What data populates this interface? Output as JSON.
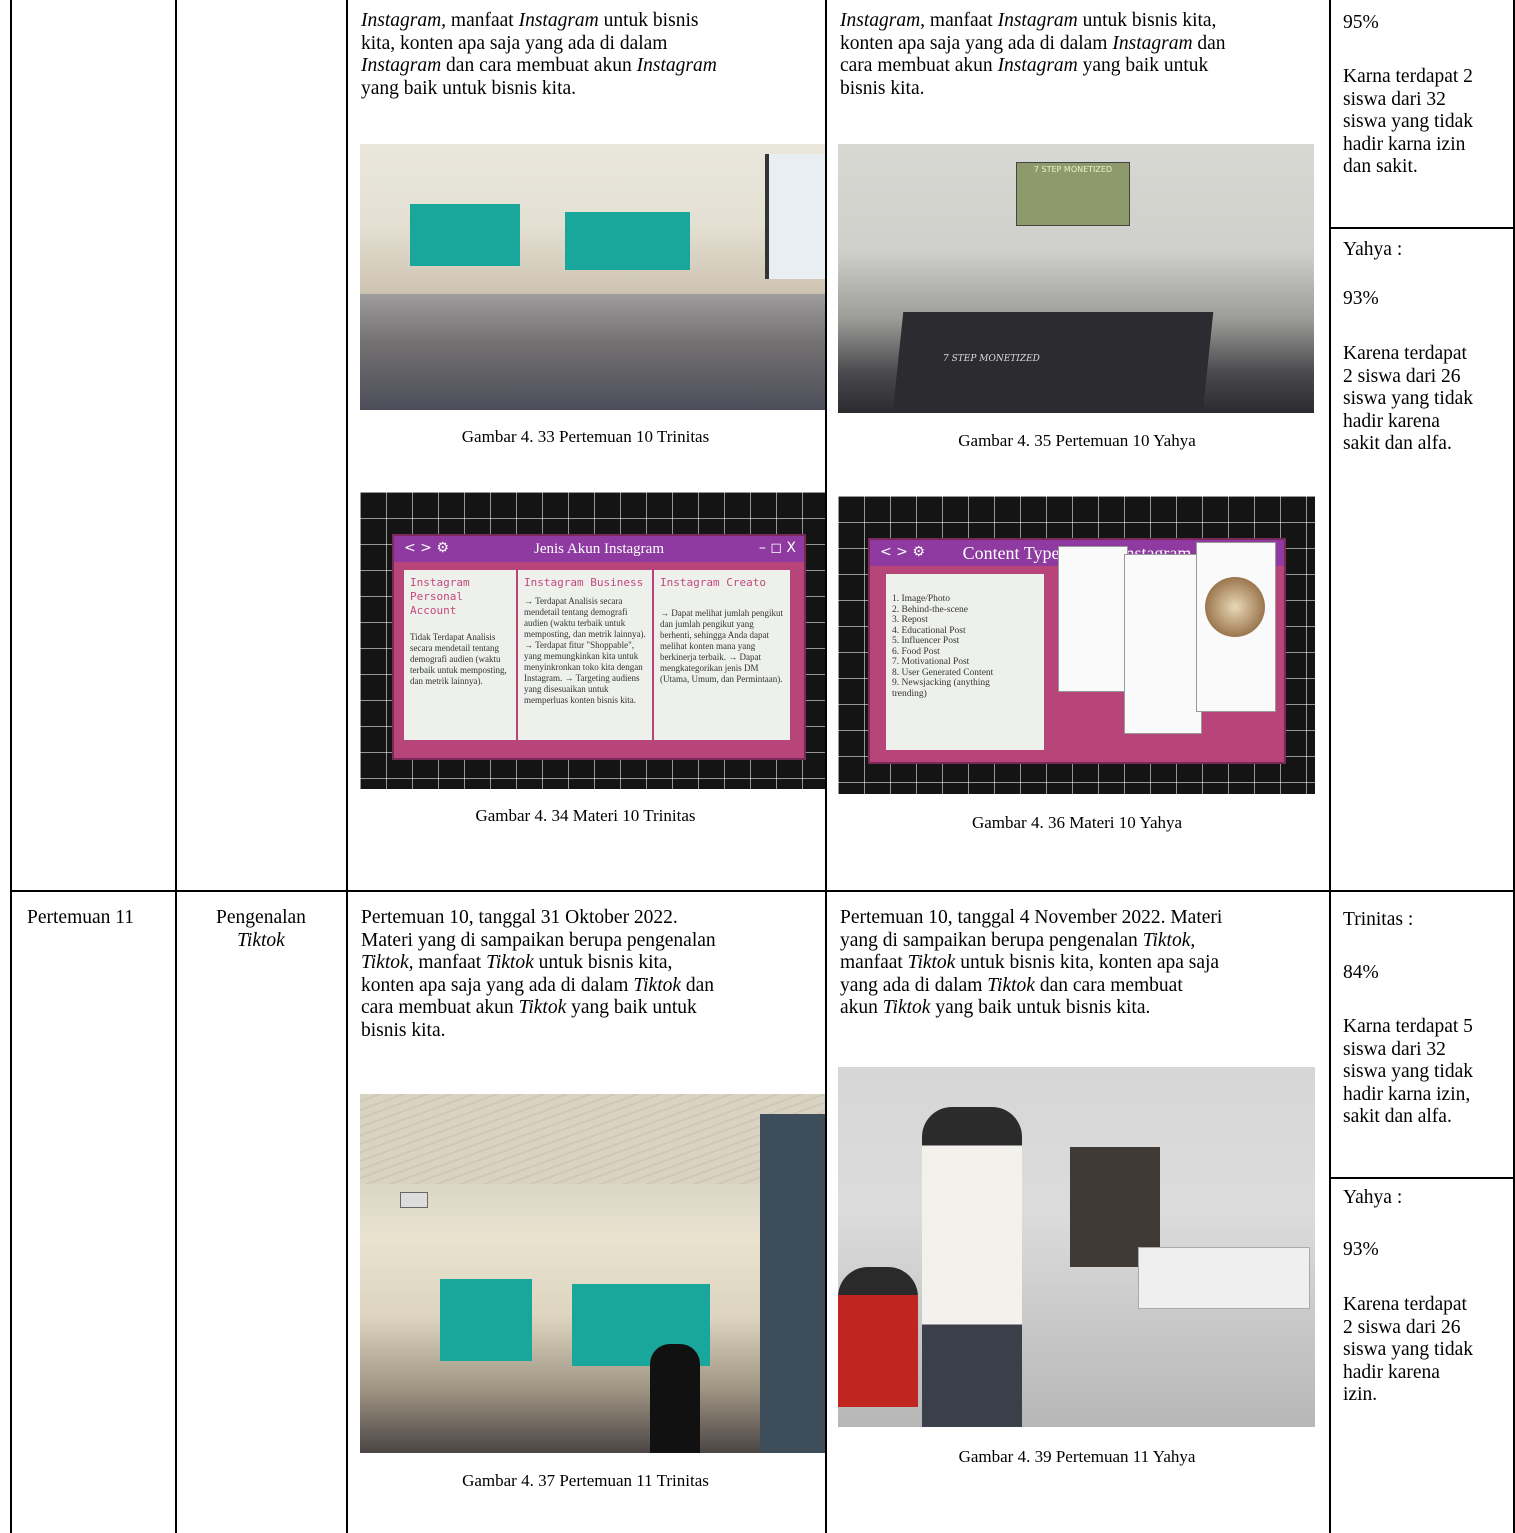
{
  "top_row": {
    "trinitas_text_lines": [
      [
        "Instagram,",
        " manfaat ",
        "Instagram",
        " untuk bisnis"
      ],
      [
        "kita, konten apa saja yang ada di dalam"
      ],
      [
        "Instagram",
        " dan cara membuat akun ",
        "Instagram"
      ],
      [
        "yang baik untuk bisnis kita."
      ]
    ],
    "yahya_text_lines": [
      [
        "Instagram,",
        " manfaat ",
        "Instagram",
        " untuk bisnis kita,"
      ],
      [
        "konten apa saja yang ada di dalam ",
        "Instagram",
        " dan"
      ],
      [
        "cara membuat akun ",
        "Instagram",
        " yang baik untuk"
      ],
      [
        "bisnis kita."
      ]
    ],
    "captions": {
      "fig33": "Gambar 4. 33 Pertemuan 10 Trinitas",
      "fig34": "Gambar 4. 34 Materi 10 Trinitas",
      "fig35": "Gambar 4. 35 Pertemuan 10 Yahya",
      "fig36": "Gambar 4. 36 Materi 10 Yahya"
    },
    "attendance_trinitas": {
      "percent": "95%",
      "reason_lines": [
        "Karna terdapat 2",
        "siswa dari 32",
        "siswa yang tidak",
        "hadir karna izin",
        "dan sakit."
      ]
    },
    "attendance_yahya": {
      "label": "Yahya :",
      "percent": "93%",
      "reason_lines": [
        "Karena terdapat",
        "2 siswa dari 26",
        "siswa yang tidak",
        "hadir karena",
        "sakit dan alfa."
      ]
    },
    "slide1": {
      "title": "Jenis Akun Instagram",
      "col1_title_lines": [
        "Instagram",
        "Personal",
        "Account"
      ],
      "col1_body": "Tidak Terdapat Analisis secara mendetail tentang demografi audien (waktu terbaik untuk memposting, dan metrik lainnya).",
      "col2_title": "Instagram Business",
      "col2_body": "→ Terdapat Analisis secara mendetail tentang demografi audien (waktu terbaik untuk memposting, dan metrik lainnya). → Terdapat fitur \"Shoppable\", yang memungkinkan kita untuk menyinkronkan toko kita dengan Instagram. → Targeting audiens yang disesuaikan untuk memperluas konten bisnis kita.",
      "col3_title": "Instagram Creato",
      "col3_body": "→ Dapat melihat jumlah pengikut dan jumlah pengikut yang berhenti, sehingga Anda dapat melihat konten mana yang berkinerja terbaik. → Dapat mengkategorikan jenis DM (Utama, Umum, dan Permintaan)."
    },
    "slide2": {
      "title": "Content Types dalam Instagram",
      "items": [
        "1. Image/Photo",
        "2. Behind-the-scene",
        "3. Repost",
        "4. Educational Post",
        "5. Influencer Post",
        "6. Food Post",
        "7. Motivational Post",
        "8. User Generated Content",
        "9. Newsjacking (anything",
        "trending)"
      ]
    },
    "slide_controls_left": "< > ⚙",
    "slide_controls_right": "– ◻ X",
    "screen_text": "7 STEP MONETIZED"
  },
  "bottom_row": {
    "meeting": "Pertemuan 11",
    "topic_line1": "Pengenalan",
    "topic_line2": "Tiktok",
    "trinitas_text_lines": [
      [
        "Pertemuan 10, tanggal 31 Oktober 2022."
      ],
      [
        "Materi yang di sampaikan berupa pengenalan"
      ],
      [
        "Tiktok,",
        " manfaat ",
        "Tiktok",
        " untuk bisnis kita,"
      ],
      [
        "konten apa saja yang ada di dalam ",
        "Tiktok",
        " dan"
      ],
      [
        "cara membuat akun ",
        "Tiktok",
        " yang baik untuk"
      ],
      [
        "bisnis kita."
      ]
    ],
    "yahya_text_lines": [
      [
        "Pertemuan 10, tanggal 4 November 2022. Materi"
      ],
      [
        "yang di sampaikan berupa pengenalan ",
        "Tiktok,"
      ],
      [
        "manfaat ",
        "Tiktok",
        " untuk bisnis kita, konten apa saja"
      ],
      [
        "yang ada di dalam ",
        "Tiktok",
        " dan cara membuat"
      ],
      [
        "akun ",
        "Tiktok",
        " yang baik untuk bisnis kita."
      ]
    ],
    "captions": {
      "fig37": "Gambar 4. 37 Pertemuan 11 Trinitas",
      "fig39": "Gambar 4. 39 Pertemuan 11 Yahya"
    },
    "attendance_trinitas": {
      "label": "Trinitas :",
      "percent": "84%",
      "reason_lines": [
        "Karna terdapat 5",
        "siswa dari 32",
        "siswa yang tidak",
        "hadir karna izin,",
        "sakit dan alfa."
      ]
    },
    "attendance_yahya": {
      "label": "Yahya :",
      "percent": "93%",
      "reason_lines": [
        "Karena terdapat",
        "2 siswa dari 26",
        "siswa yang tidak",
        "hadir karena",
        "izin."
      ]
    }
  }
}
